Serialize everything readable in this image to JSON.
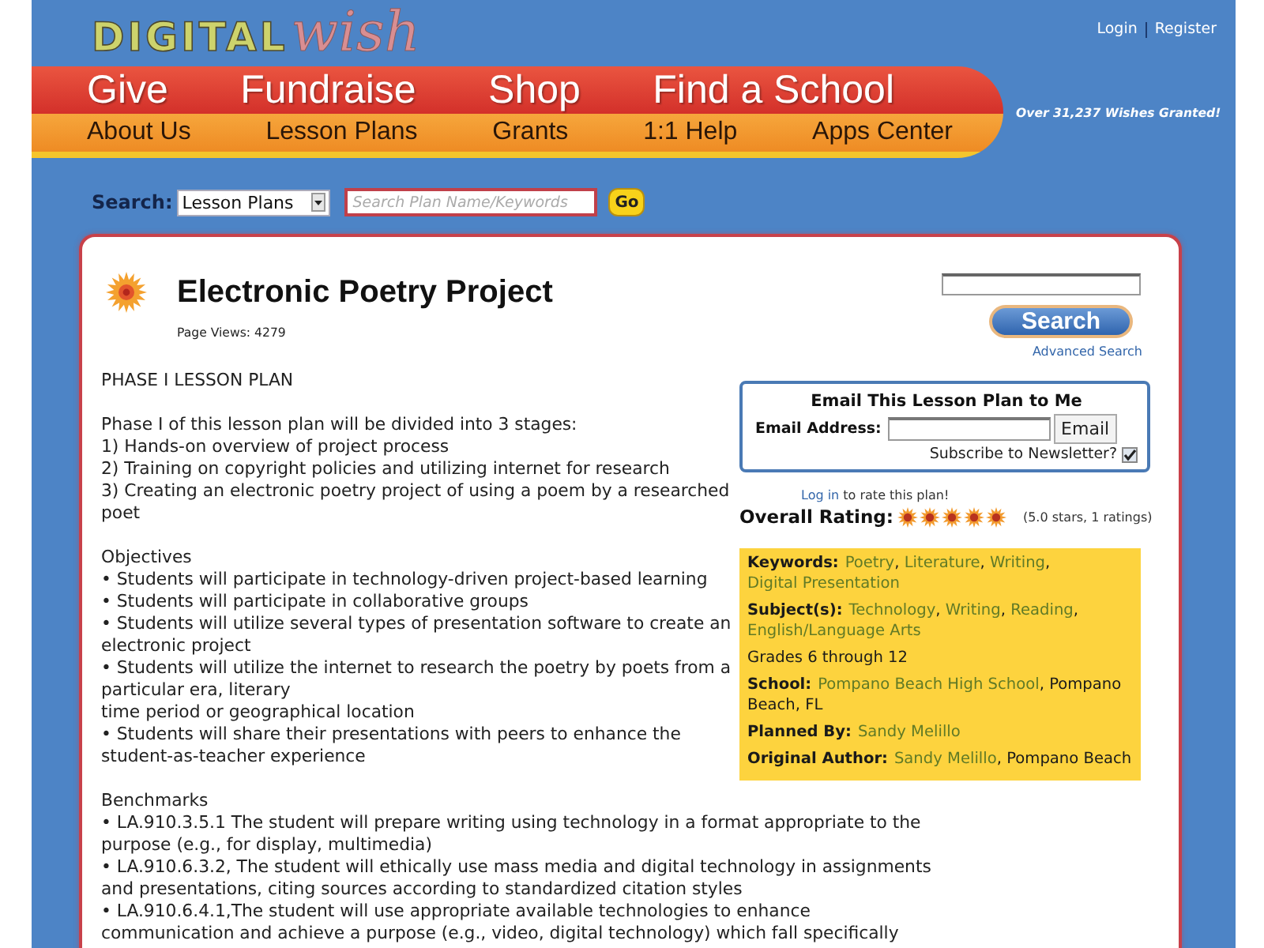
{
  "logo": {
    "main": "DIGITAL",
    "accent": "wish"
  },
  "account_links": [
    "Login",
    "Register"
  ],
  "main_nav": [
    "Give",
    "Fundraise",
    "Shop",
    "Find a School"
  ],
  "sub_nav": [
    "About Us",
    "Lesson Plans",
    "Grants",
    "1:1 Help",
    "Apps Center"
  ],
  "tagline": "Over 31,237 Wishes Granted!",
  "search": {
    "label": "Search:",
    "category": "Lesson Plans",
    "placeholder": "Search Plan Name/Keywords",
    "button": "Go"
  },
  "plan": {
    "title": "Electronic Poetry Project",
    "page_views": "Page Views: 4279",
    "body_sections": [
      [
        "PHASE I LESSON PLAN"
      ],
      [
        "Phase I of this lesson plan will be divided into 3 stages:",
        "1) Hands-on overview of project process",
        "2) Training on copyright policies and utilizing internet for research",
        "3) Creating an electronic poetry project of using a poem by a researched poet"
      ],
      [
        "Objectives",
        "• Students will participate in technology-driven project-based learning",
        "• Students will participate in collaborative groups",
        "• Students will utilize several types of presentation software to create an electronic project",
        "• Students will utilize the internet to research the poetry by poets from a particular era, literary",
        "time period or geographical location",
        "• Students will share their presentations with peers to enhance the student-as-teacher experience"
      ],
      [
        "Benchmarks",
        "• LA.910.3.5.1 The student will prepare writing using technology in a format appropriate to the purpose (e.g., for display, multimedia)",
        "• LA.910.6.3.2, The student will ethically use mass media and digital technology in assignments and presentations, citing sources according to standardized citation styles",
        "• LA.910.6.4.1,The student will use appropriate available technologies to enhance communication and achieve a purpose (e.g., video, digital technology) which fall specifically"
      ]
    ]
  },
  "site_search": {
    "button": "Search",
    "link": "Advanced Search"
  },
  "email_form": {
    "title": "Email This Lesson Plan to Me",
    "label": "Email Address:",
    "button": "Email",
    "newsletter_label": "Subscribe to Newsletter?",
    "newsletter_checked": true
  },
  "rating": {
    "prompt": [
      {
        "kind": "link",
        "text": "Log in"
      },
      {
        "kind": "text",
        "text": " to rate this plan!"
      }
    ],
    "label": "Overall Rating:",
    "stars": 5,
    "summary": "(5.0 stars, 1 ratings)"
  },
  "details": [
    {
      "parts": [
        {
          "kind": "label",
          "text": "Keywords:"
        },
        {
          "kind": "link",
          "text": "Poetry"
        },
        {
          "kind": "text",
          "text": ", "
        },
        {
          "kind": "link",
          "text": "Literature"
        },
        {
          "kind": "text",
          "text": ", "
        },
        {
          "kind": "link",
          "text": "Writing"
        },
        {
          "kind": "text",
          "text": ", "
        },
        {
          "kind": "link",
          "text": "Digital Presentation"
        }
      ]
    },
    {
      "parts": [
        {
          "kind": "label",
          "text": "Subject(s):"
        },
        {
          "kind": "link",
          "text": "Technology"
        },
        {
          "kind": "text",
          "text": ", "
        },
        {
          "kind": "link",
          "text": "Writing"
        },
        {
          "kind": "text",
          "text": ", "
        },
        {
          "kind": "link",
          "text": "Reading"
        },
        {
          "kind": "text",
          "text": ", "
        },
        {
          "kind": "link",
          "text": "English/Language Arts"
        }
      ]
    },
    {
      "parts": [
        {
          "kind": "text",
          "text": "Grades 6 through 12"
        }
      ]
    },
    {
      "parts": [
        {
          "kind": "label",
          "text": "School:"
        },
        {
          "kind": "link",
          "text": "Pompano Beach High School"
        },
        {
          "kind": "text",
          "text": ", Pompano Beach, FL"
        }
      ]
    },
    {
      "parts": [
        {
          "kind": "label",
          "text": "Planned By:"
        },
        {
          "kind": "link",
          "text": "Sandy Melillo"
        }
      ]
    },
    {
      "parts": [
        {
          "kind": "label",
          "text": "Original Author:"
        },
        {
          "kind": "link",
          "text": "Sandy Melillo"
        },
        {
          "kind": "text",
          "text": ", Pompano Beach"
        }
      ]
    }
  ]
}
